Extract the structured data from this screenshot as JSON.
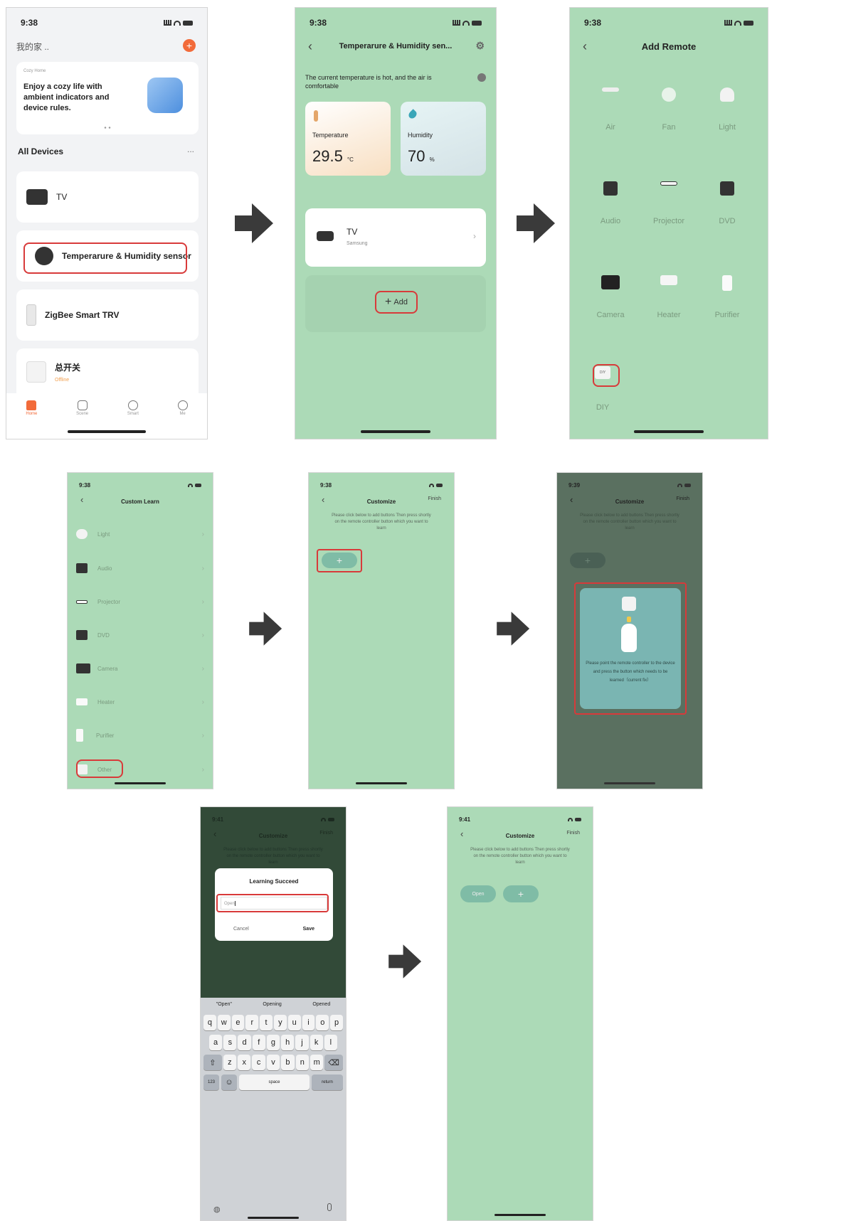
{
  "time": "9:38",
  "screen1": {
    "home_label": "我的家 ..",
    "banner_small": "Cozy Home",
    "banner_text": "Enjoy a cozy life with ambient indicators and device rules.",
    "section_title": "All Devices",
    "more": "...",
    "devices": [
      {
        "name": "TV"
      },
      {
        "name": "Temperarure & Humidity sensor"
      },
      {
        "name": "ZigBee Smart TRV"
      },
      {
        "name": "总开关",
        "status": "Offline"
      }
    ],
    "tabs": [
      "Home",
      "Scene",
      "Smart",
      "Me"
    ]
  },
  "screen2": {
    "title": "Temperarure & Humidity sen...",
    "message": "The current temperature is hot,  and the air is comfortable",
    "temp_label": "Temperature",
    "temp_value": "29.5",
    "temp_unit": "°C",
    "hum_label": "Humidity",
    "hum_value": "70",
    "hum_unit": "%",
    "device_name": "TV",
    "device_brand": "Samsung",
    "add_label": "Add"
  },
  "screen3": {
    "title": "Add Remote",
    "items": [
      "Air",
      "Fan",
      "Light",
      "Audio",
      "Projector",
      "DVD",
      "Camera",
      "Heater",
      "Purifier",
      "DIY"
    ],
    "diy_badge": "DIY"
  },
  "screen4": {
    "time": "9:38",
    "title": "Custom Learn",
    "items": [
      "Light",
      "Audio",
      "Projector",
      "DVD",
      "Camera",
      "Heater",
      "Purifier",
      "Other"
    ]
  },
  "screen5": {
    "time": "9:38",
    "title": "Customize",
    "finish": "Finish",
    "hint": "Please click below to add buttons Then press shortly on the remote controller button which you want to learn",
    "plus": "+"
  },
  "screen6": {
    "time": "9:39",
    "title": "Customize",
    "finish": "Finish",
    "hint": "Please click below to add buttons Then press shortly on the remote controller button which you want to learn",
    "plus": "+",
    "popup_text": "Please point the remote controller to the device and press the button which needs to be learned（current fix）"
  },
  "screen7": {
    "time": "9:41",
    "title": "Customize",
    "finish": "Finish",
    "hint": "Please click below to add buttons Then press shortly on the remote controller button which you want to learn",
    "dialog_title": "Learning Succeed",
    "input_value": "Open",
    "cancel": "Cancel",
    "save": "Save",
    "suggestions": [
      "\"Open\"",
      "Opening",
      "Opened"
    ],
    "row1": [
      "q",
      "w",
      "e",
      "r",
      "t",
      "y",
      "u",
      "i",
      "o",
      "p"
    ],
    "row2": [
      "a",
      "s",
      "d",
      "f",
      "g",
      "h",
      "j",
      "k",
      "l"
    ],
    "row3": [
      "z",
      "x",
      "c",
      "v",
      "b",
      "n",
      "m"
    ],
    "num_key": "123",
    "space_key": "space",
    "return_key": "return"
  },
  "screen8": {
    "time": "9:41",
    "title": "Customize",
    "finish": "Finish",
    "hint": "Please click below to add buttons Then press shortly on the remote controller button which you want to learn",
    "open_button": "Open",
    "plus": "+"
  },
  "colors": {
    "screen_green": "#acdab7",
    "highlight_red": "#d83a3a",
    "accent_orange": "#f26b3a",
    "arrow": "#3a3a3a"
  }
}
